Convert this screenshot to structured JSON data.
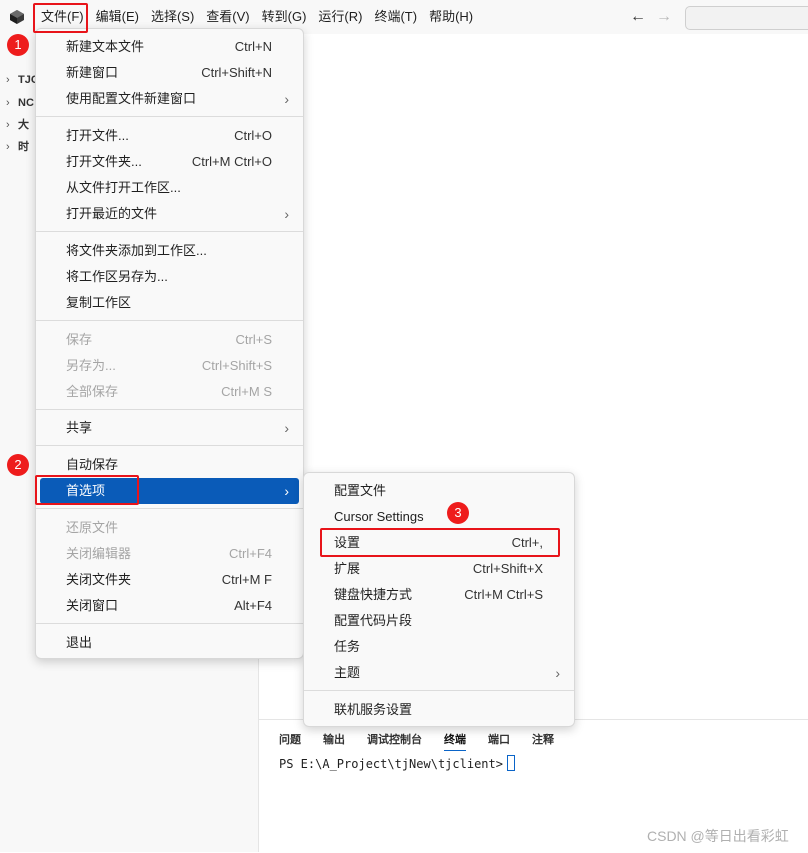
{
  "menubar": {
    "items": [
      "文件(F)",
      "编辑(E)",
      "选择(S)",
      "查看(V)",
      "转到(G)",
      "运行(R)",
      "终端(T)",
      "帮助(H)"
    ],
    "back_icon": "arrow-left-icon",
    "forward_icon": "arrow-right-icon"
  },
  "sidebar": {
    "tree": [
      "TJC",
      "NC",
      "大",
      "时"
    ]
  },
  "file_menu": {
    "new_text_file": {
      "label": "新建文本文件",
      "shortcut": "Ctrl+N"
    },
    "new_window": {
      "label": "新建窗口",
      "shortcut": "Ctrl+Shift+N"
    },
    "new_window_profile": {
      "label": "使用配置文件新建窗口"
    },
    "open_file": {
      "label": "打开文件...",
      "shortcut": "Ctrl+O"
    },
    "open_folder": {
      "label": "打开文件夹...",
      "shortcut": "Ctrl+M Ctrl+O"
    },
    "open_workspace": {
      "label": "从文件打开工作区..."
    },
    "open_recent": {
      "label": "打开最近的文件"
    },
    "add_folder": {
      "label": "将文件夹添加到工作区..."
    },
    "save_workspace_as": {
      "label": "将工作区另存为..."
    },
    "duplicate_workspace": {
      "label": "复制工作区"
    },
    "save": {
      "label": "保存",
      "shortcut": "Ctrl+S"
    },
    "save_as": {
      "label": "另存为...",
      "shortcut": "Ctrl+Shift+S"
    },
    "save_all": {
      "label": "全部保存",
      "shortcut": "Ctrl+M S"
    },
    "share": {
      "label": "共享"
    },
    "auto_save": {
      "label": "自动保存"
    },
    "preferences": {
      "label": "首选项"
    },
    "revert_file": {
      "label": "还原文件"
    },
    "close_editor": {
      "label": "关闭编辑器",
      "shortcut": "Ctrl+F4"
    },
    "close_folder": {
      "label": "关闭文件夹",
      "shortcut": "Ctrl+M F"
    },
    "close_window": {
      "label": "关闭窗口",
      "shortcut": "Alt+F4"
    },
    "exit": {
      "label": "退出"
    }
  },
  "pref_menu": {
    "profiles": {
      "label": "配置文件"
    },
    "cursor_settings": {
      "label": "Cursor Settings"
    },
    "settings": {
      "label": "设置",
      "shortcut": "Ctrl+,"
    },
    "extensions": {
      "label": "扩展",
      "shortcut": "Ctrl+Shift+X"
    },
    "keyboard_shortcuts": {
      "label": "键盘快捷方式",
      "shortcut": "Ctrl+M Ctrl+S"
    },
    "snippets": {
      "label": "配置代码片段"
    },
    "tasks": {
      "label": "任务"
    },
    "themes": {
      "label": "主题"
    },
    "online_services": {
      "label": "联机服务设置"
    }
  },
  "panel": {
    "tabs": [
      "问题",
      "输出",
      "调试控制台",
      "终端",
      "端口",
      "注释"
    ],
    "active_tab": "终端",
    "terminal_prompt": "PS E:\\A_Project\\tjNew\\tjclient>"
  },
  "annotations": {
    "badge1": "1",
    "badge2": "2",
    "badge3": "3",
    "color": "#e8141a"
  },
  "colors": {
    "highlight": "#0a5bb8",
    "accent": "#0a64c8"
  },
  "watermark": "CSDN @等日出看彩虹"
}
